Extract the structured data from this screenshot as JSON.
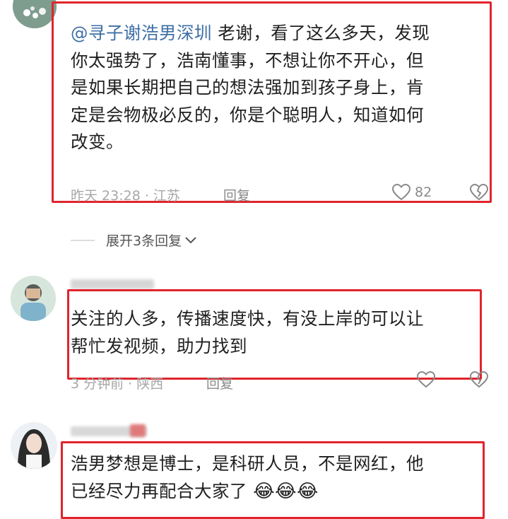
{
  "comments": [
    {
      "mention": "@寻子谢浩男深圳",
      "text_lines": [
        "老谢，看了这么多天，发现",
        "你太强势了，浩南懂事，不想让你不开心，但",
        "是如果长期把自己的想法强加到孩子身上，肯",
        "定是会物极必反的，你是个聪明人，知道如何",
        "改变。"
      ],
      "time": "昨天 23:28 · 江苏",
      "reply_label": "回复",
      "likes": "82",
      "like_icon": "heart-outline-icon",
      "dislike_icon": "broken-heart-icon"
    },
    {
      "text_lines": [
        "关注的人多，传播速度快，有没上岸的可以让",
        "帮忙发视频，助力找到"
      ],
      "time": "3 分钟前 · 陕西",
      "reply_label": "回复",
      "like_icon": "heart-outline-icon",
      "dislike_icon": "broken-heart-icon"
    },
    {
      "text_lines": [
        "浩男梦想是博士，是科研人员，不是网红，他",
        "已经尽力再配合大家了"
      ],
      "emoji": "😂😂😂"
    }
  ],
  "expand": {
    "label": "展开3条回复",
    "icon": "chevron-down-icon"
  },
  "colors": {
    "highlight": "#e0242c",
    "mention": "#3f6fa6",
    "meta": "#a7a7a7"
  }
}
